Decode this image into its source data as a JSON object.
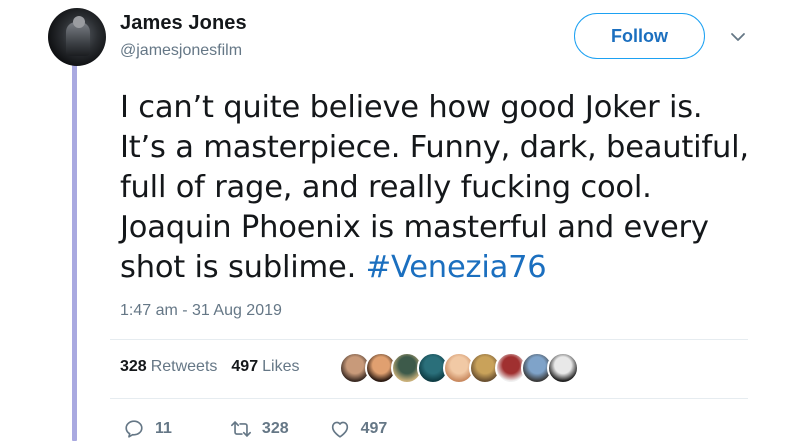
{
  "author": {
    "name": "James Jones",
    "handle": "@jamesjonesfilm"
  },
  "follow_label": "Follow",
  "tweet": {
    "lines": [
      "I can’t quite believe how good Joker is.",
      "It’s a masterpiece. Funny, dark, beautiful,",
      "full of rage, and really fucking cool.",
      "Joaquin Phoenix is masterful and every",
      "shot is sublime. "
    ],
    "hashtag": "#Venezia76",
    "timestamp": "1:47 am - 31 Aug 2019"
  },
  "stats": {
    "retweets_count": "328",
    "retweets_label": "Retweets",
    "likes_count": "497",
    "likes_label": "Likes"
  },
  "actions": {
    "reply_count": "11",
    "retweet_count": "328",
    "like_count": "497"
  },
  "likers": [
    {
      "colors": [
        "#c89a7a",
        "#3a2a22"
      ]
    },
    {
      "colors": [
        "#e0a070",
        "#2b1a12"
      ]
    },
    {
      "colors": [
        "#3d5a4a",
        "#c9b07a"
      ]
    },
    {
      "colors": [
        "#2a6f7a",
        "#0e3c44"
      ]
    },
    {
      "colors": [
        "#f1c9a5",
        "#c98a60"
      ]
    },
    {
      "colors": [
        "#c9a25a",
        "#6a5030"
      ]
    },
    {
      "colors": [
        "#a03030",
        "#f0f0f0"
      ]
    },
    {
      "colors": [
        "#7fa3c9",
        "#3a3a3a"
      ]
    },
    {
      "colors": [
        "#e8e8e8",
        "#202020"
      ]
    }
  ],
  "colors": {
    "accent": "#1da1f2",
    "link": "#1b6fbf",
    "muted": "#657786",
    "thread_line": "#a9a9e0"
  },
  "icons": {
    "more": "chevron-down-icon",
    "reply": "reply-icon",
    "retweet": "retweet-icon",
    "like": "heart-icon"
  }
}
